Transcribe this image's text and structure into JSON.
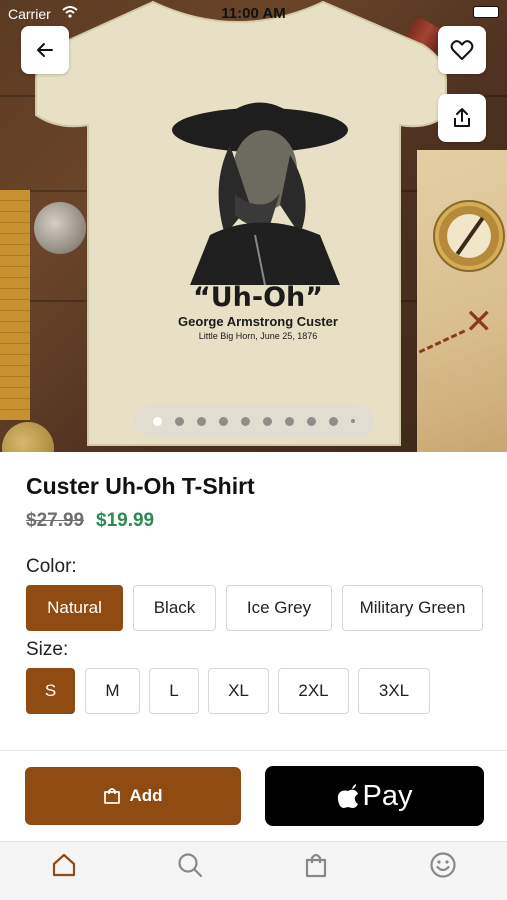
{
  "status_bar": {
    "carrier": "Carrier",
    "time": "11:00 AM"
  },
  "hero": {
    "print_headline": "“Uh-Oh”",
    "print_name": "George Armstrong Custer",
    "print_caption": "Little Big Horn, June 25, 1876",
    "pager": {
      "count": 10,
      "active_index": 0
    }
  },
  "product": {
    "title": "Custer Uh-Oh T-Shirt",
    "price_original": "$27.99",
    "price_sale": "$19.99"
  },
  "color": {
    "label": "Color:",
    "options": [
      "Natural",
      "Black",
      "Ice Grey",
      "Military Green"
    ],
    "selected": "Natural"
  },
  "size": {
    "label": "Size:",
    "options": [
      "S",
      "M",
      "L",
      "XL",
      "2XL",
      "3XL"
    ],
    "selected": "S"
  },
  "actions": {
    "add_label": "Add",
    "pay_label": "Pay"
  },
  "tabs": [
    {
      "name": "home",
      "icon": "home-icon",
      "active": true
    },
    {
      "name": "search",
      "icon": "search-icon",
      "active": false
    },
    {
      "name": "cart",
      "icon": "bag-icon",
      "active": false
    },
    {
      "name": "account",
      "icon": "smiley-icon",
      "active": false
    }
  ],
  "colors": {
    "accent": "#8f4b12",
    "sale_price": "#2c8a52",
    "pay_button": "#000000"
  }
}
